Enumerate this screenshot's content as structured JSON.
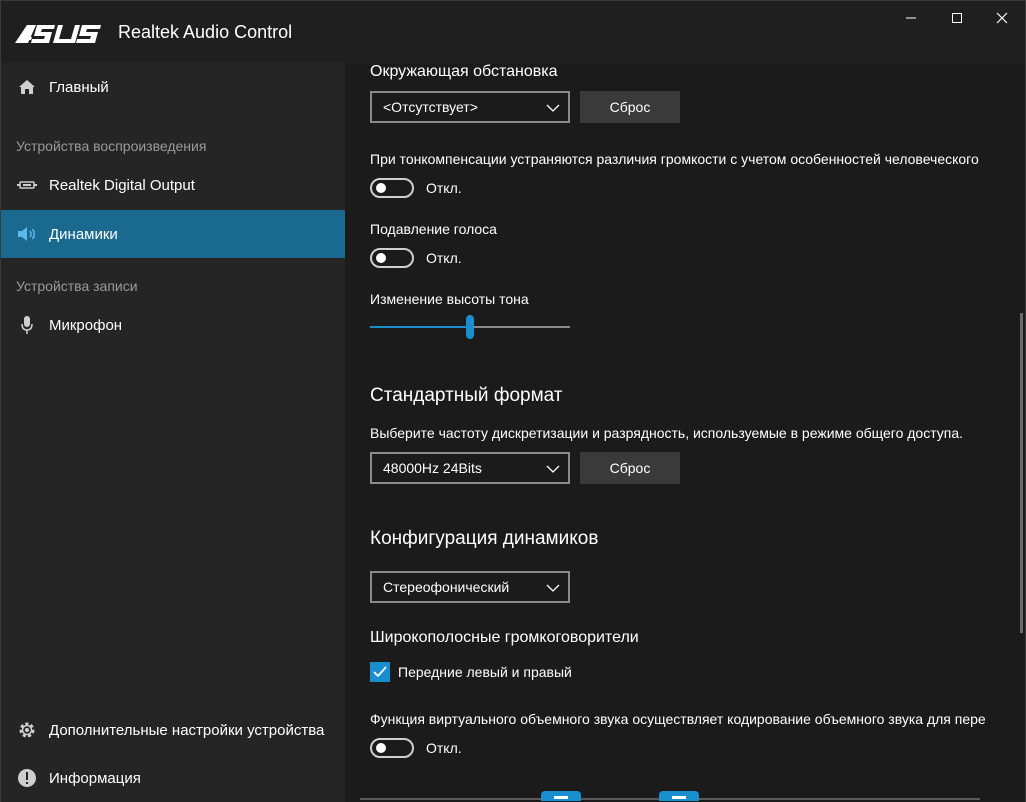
{
  "app": {
    "title": "Realtek Audio Control",
    "brand": "ASUS",
    "accent_color": "#1a6a8f"
  },
  "window_controls": {
    "minimize_icon": "minimize-icon",
    "maximize_icon": "maximize-icon",
    "close_icon": "close-icon"
  },
  "sidebar": {
    "home": {
      "label": "Главный",
      "icon": "home-icon"
    },
    "playback_header": "Устройства воспроизведения",
    "playback_items": [
      {
        "label": "Realtek Digital Output",
        "icon": "digital-output-icon"
      },
      {
        "label": "Динамики",
        "icon": "speaker-icon",
        "active": true
      }
    ],
    "record_header": "Устройства записи",
    "record_items": [
      {
        "label": "Микрофон",
        "icon": "microphone-icon"
      }
    ],
    "advanced": {
      "label": "Дополнительные настройки устройства",
      "icon": "gear-icon"
    },
    "info": {
      "label": "Информация",
      "icon": "info-icon"
    }
  },
  "content": {
    "environment": {
      "title": "Окружающая обстановка",
      "select_value": "<Отсутствует>",
      "reset_label": "Сброс"
    },
    "loudness": {
      "description": "При тонкомпенсации устраняются различия громкости с учетом особенностей человеческого",
      "state": "Откл."
    },
    "voice_cancel": {
      "title": "Подавление голоса",
      "state": "Откл."
    },
    "pitch": {
      "title": "Изменение высоты тона",
      "value_fraction": 0.5
    },
    "default_format": {
      "title": "Стандартный формат",
      "description": "Выберите частоту дискретизации и разрядность, используемые в режиме общего доступа.",
      "select_value": "48000Hz 24Bits",
      "reset_label": "Сброс"
    },
    "speaker_config": {
      "title": "Конфигурация динамиков",
      "select_value": "Стереофонический"
    },
    "fullrange": {
      "title": "Широкополосные громкоговорители",
      "checkbox_label": "Передние левый и правый",
      "checked": true
    },
    "virtual_surround": {
      "description": "Функция виртуального объемного звука осуществляет кодирование объемного звука для пере",
      "state": "Откл."
    }
  }
}
